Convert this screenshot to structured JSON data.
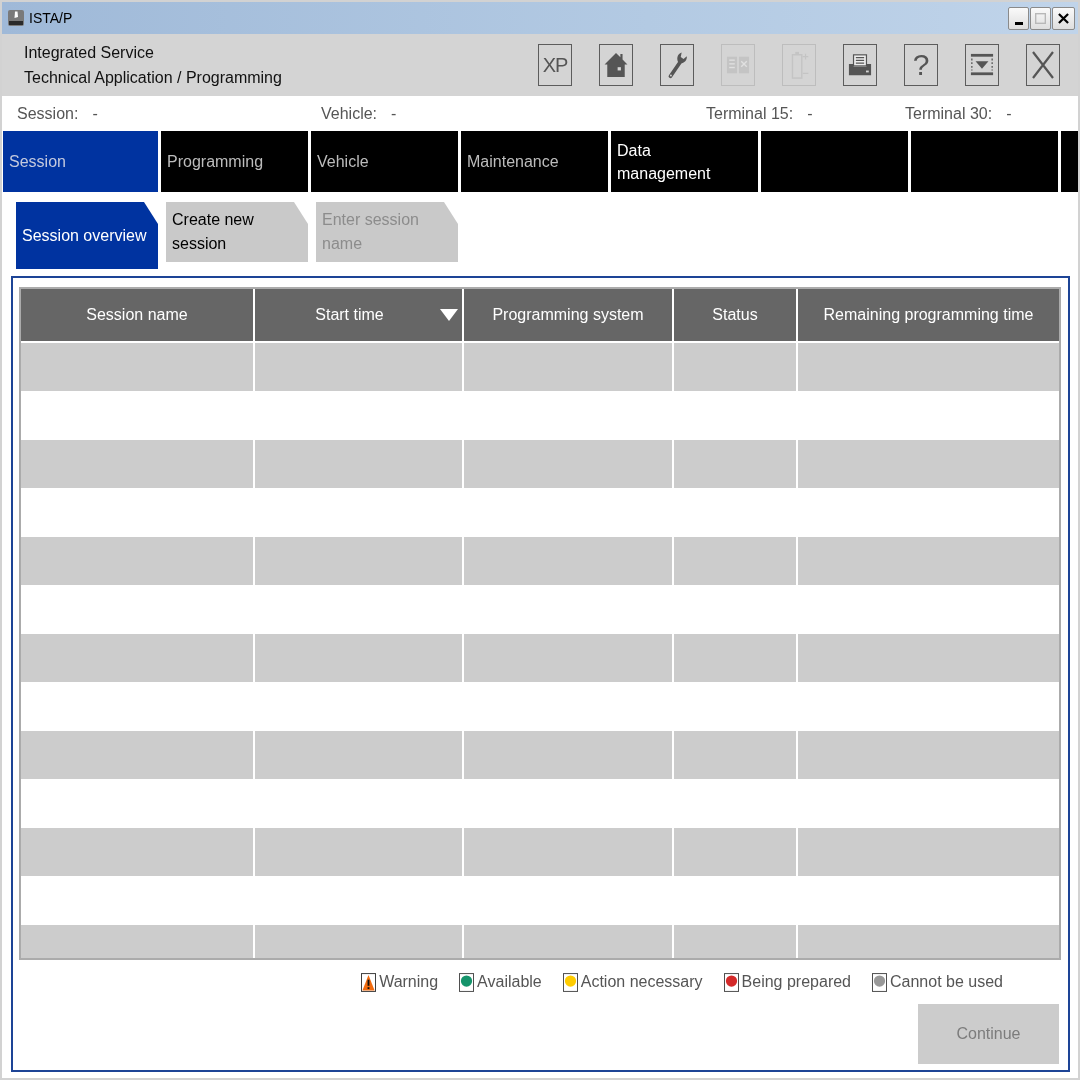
{
  "window": {
    "title": "ISTA/P",
    "controls": [
      {
        "kind": "minimize",
        "disabled": false
      },
      {
        "kind": "maximize",
        "disabled": true
      },
      {
        "kind": "close",
        "disabled": false
      }
    ]
  },
  "header": {
    "title_lines": [
      "Integrated Service",
      "Technical Application / Programming"
    ],
    "toolbar": [
      {
        "kind": "xp",
        "label": "XP",
        "disabled": false
      },
      {
        "kind": "home",
        "disabled": false
      },
      {
        "kind": "wrench",
        "disabled": false
      },
      {
        "kind": "compare",
        "disabled": true
      },
      {
        "kind": "battery",
        "disabled": true
      },
      {
        "kind": "printer",
        "disabled": false
      },
      {
        "kind": "help",
        "label": "?",
        "disabled": false
      },
      {
        "kind": "eject",
        "disabled": false
      },
      {
        "kind": "exit",
        "disabled": false
      }
    ]
  },
  "info_bar": [
    {
      "label": "Session:",
      "value": "-"
    },
    {
      "label": "Vehicle:",
      "value": "-"
    },
    {
      "label": "Terminal 15:",
      "value": "-"
    },
    {
      "label": "Terminal 30:",
      "value": "-"
    }
  ],
  "main_tabs": [
    {
      "label": "Session",
      "selected": true,
      "disabled": false
    },
    {
      "label": "Programming",
      "selected": false,
      "disabled": true
    },
    {
      "label": "Vehicle",
      "selected": false,
      "disabled": true
    },
    {
      "label": "Maintenance",
      "selected": false,
      "disabled": true
    },
    {
      "label": "Data management",
      "selected": false,
      "disabled": false
    }
  ],
  "sub_tabs": [
    {
      "label": "Session overview",
      "selected": true,
      "disabled": false
    },
    {
      "label": "Create new session",
      "selected": false,
      "disabled": false
    },
    {
      "label": "Enter session name",
      "selected": false,
      "disabled": true
    }
  ],
  "table": {
    "columns": [
      {
        "label": "Session name",
        "sorted": false
      },
      {
        "label": "Start time",
        "sorted": true
      },
      {
        "label": "Programming system",
        "sorted": false
      },
      {
        "label": "Status",
        "sorted": false
      },
      {
        "label": "Remaining programming time",
        "sorted": false
      }
    ]
  },
  "legend": [
    {
      "kind": "warning",
      "label": "Warning",
      "color": "#f26b0f"
    },
    {
      "kind": "dot",
      "label": "Available",
      "color": "#15946b"
    },
    {
      "kind": "dot",
      "label": "Action necessary",
      "color": "#ffcc00"
    },
    {
      "kind": "dot",
      "label": "Being prepared",
      "color": "#d42a2a"
    },
    {
      "kind": "dot",
      "label": "Cannot be used",
      "color": "#999999"
    }
  ],
  "continue_button": {
    "label": "Continue",
    "disabled": true
  }
}
